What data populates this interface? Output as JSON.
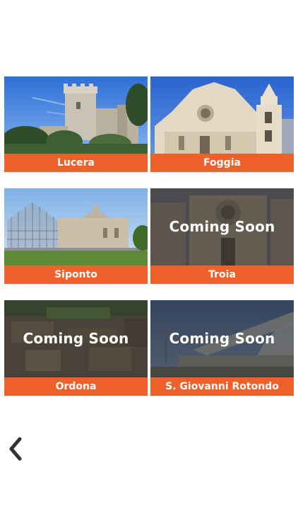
{
  "cards": [
    {
      "label": "Lucera",
      "status": "available",
      "image": "castle-photo"
    },
    {
      "label": "Foggia",
      "status": "available",
      "image": "cathedral-photo"
    },
    {
      "label": "Siponto",
      "status": "available",
      "image": "basilica-photo"
    },
    {
      "label": "Troia",
      "status": "coming_soon",
      "overlay_text": "Coming Soon",
      "image": "troia-cathedral-photo"
    },
    {
      "label": "Ordona",
      "status": "coming_soon",
      "overlay_text": "Coming Soon",
      "image": "ruins-photo"
    },
    {
      "label": "S. Giovanni Rotondo",
      "status": "coming_soon",
      "overlay_text": "Coming Soon",
      "image": "modern-church-photo"
    }
  ],
  "back_icon": "chevron-left-icon",
  "colors": {
    "label_background": "#f0602a",
    "label_text": "#ffffff",
    "overlay": "rgba(20,20,22,0.55)"
  }
}
